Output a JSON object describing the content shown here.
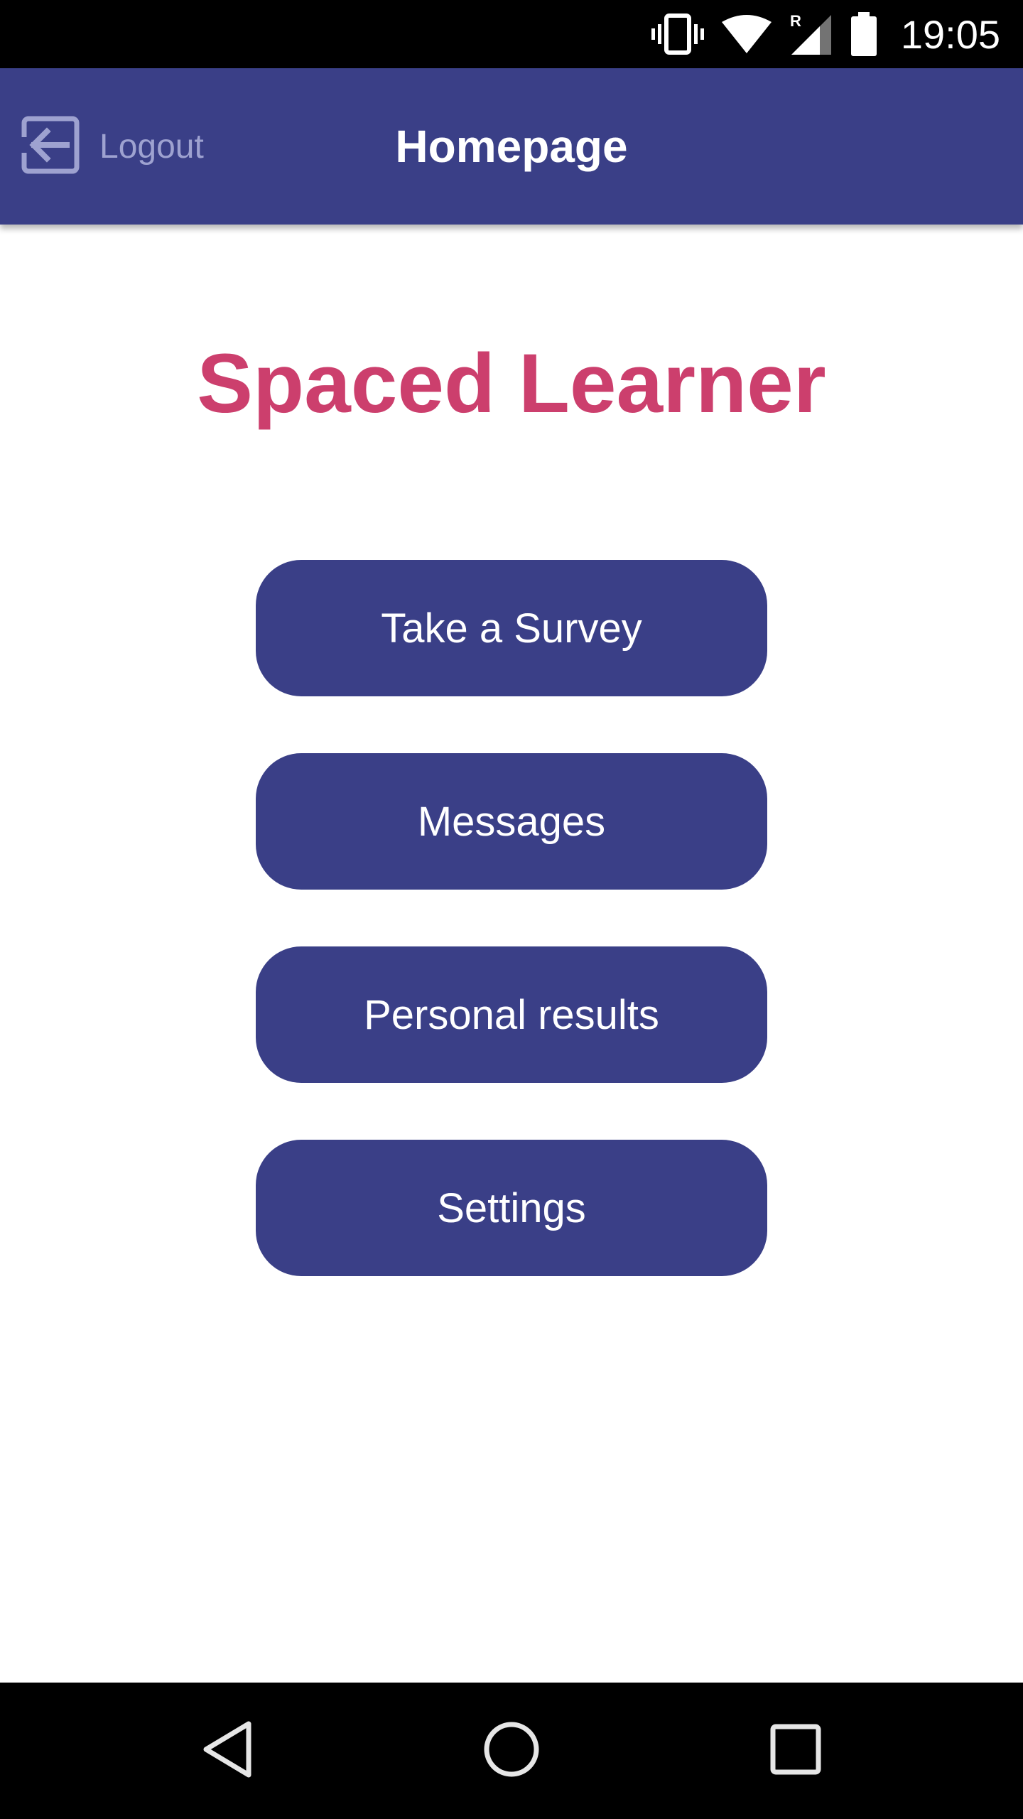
{
  "status_bar": {
    "time": "19:05",
    "icons": [
      "vibrate-icon",
      "wifi-icon",
      "cell-signal-roaming-icon",
      "battery-icon"
    ],
    "roaming_indicator": "R"
  },
  "app_bar": {
    "title": "Homepage",
    "logout_label": "Logout",
    "logout_icon": "logout-arrow-icon",
    "background_color": "#3a3f87"
  },
  "main": {
    "brand_title": "Spaced Learner",
    "brand_color": "#cc3f6d",
    "buttons": [
      {
        "label": "Take a Survey"
      },
      {
        "label": "Messages"
      },
      {
        "label": "Personal results"
      },
      {
        "label": "Settings"
      }
    ],
    "button_color": "#3a3f87"
  },
  "nav_bar": {
    "icons": [
      "back-triangle-icon",
      "home-circle-icon",
      "recents-square-icon"
    ]
  }
}
